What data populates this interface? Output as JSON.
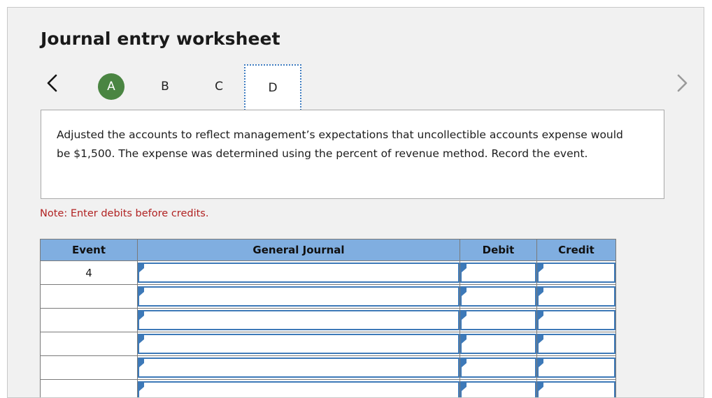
{
  "page": {
    "title": "Journal entry worksheet"
  },
  "nav": {
    "prev_icon": "chevron-left-icon",
    "next_icon": "chevron-right-icon",
    "prev_enabled": true,
    "next_enabled": false,
    "accent_green": "#4a8542",
    "focus_blue": "#3e7cc0"
  },
  "tabs": [
    {
      "label": "A",
      "state": "completed"
    },
    {
      "label": "B",
      "state": "default"
    },
    {
      "label": "C",
      "state": "default"
    },
    {
      "label": "D",
      "state": "selected"
    }
  ],
  "description": {
    "text": "Adjusted the accounts to reflect management’s expectations that uncollectible accounts expense would be $1,500. The expense was determined using the percent of revenue method. Record the event."
  },
  "note": {
    "text": "Note: Enter debits before credits.",
    "color": "#b12222"
  },
  "table": {
    "header_color": "#80aee0",
    "columns": [
      "Event",
      "General Journal",
      "Debit",
      "Credit"
    ],
    "rows": [
      {
        "event": "4",
        "general_journal": "",
        "debit": "",
        "credit": ""
      },
      {
        "event": "",
        "general_journal": "",
        "debit": "",
        "credit": ""
      },
      {
        "event": "",
        "general_journal": "",
        "debit": "",
        "credit": ""
      },
      {
        "event": "",
        "general_journal": "",
        "debit": "",
        "credit": ""
      },
      {
        "event": "",
        "general_journal": "",
        "debit": "",
        "credit": ""
      },
      {
        "event": "",
        "general_journal": "",
        "debit": "",
        "credit": ""
      }
    ]
  }
}
